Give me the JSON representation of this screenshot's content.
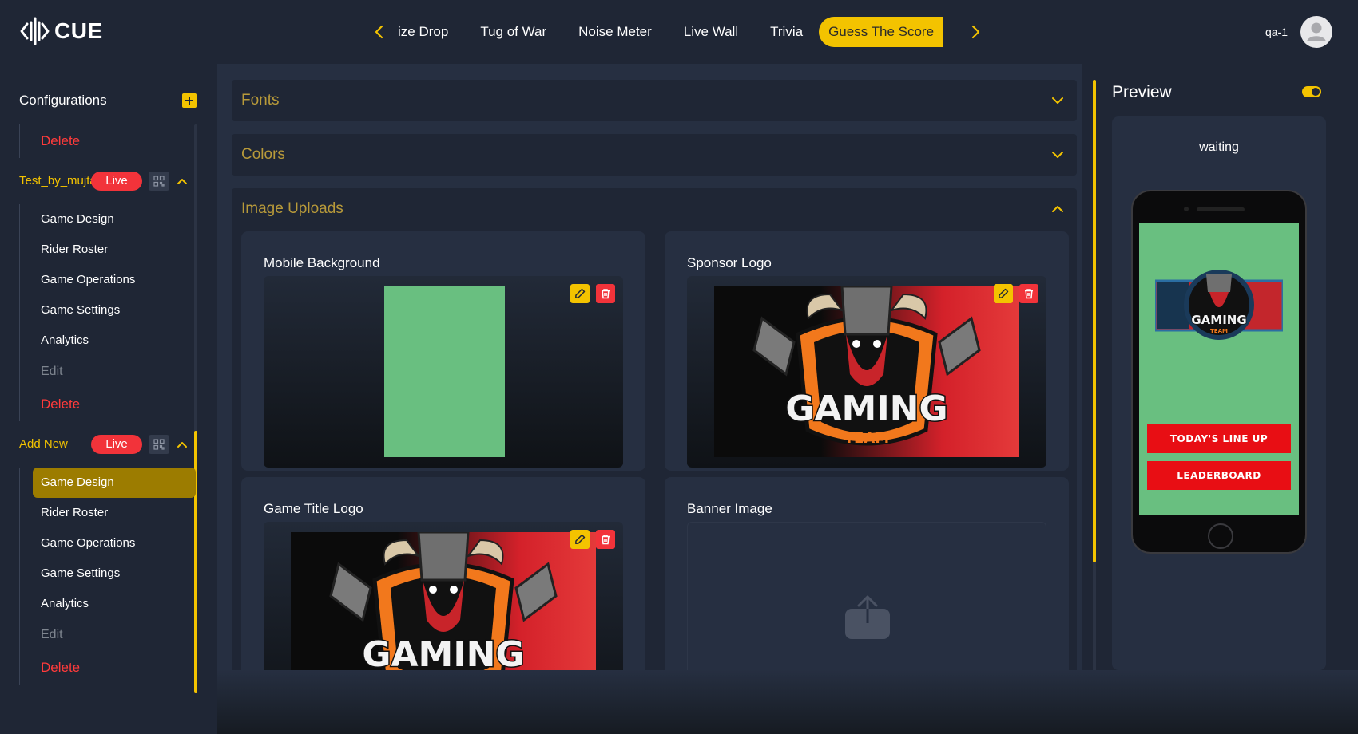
{
  "app": {
    "logo_text": "CUE"
  },
  "nav": {
    "tabs": [
      "ize Drop",
      "Tug of War",
      "Noise Meter",
      "Live Wall",
      "Trivia",
      "Guess The Score"
    ],
    "active_tab": "Guess The Score"
  },
  "user": {
    "name": "qa-1"
  },
  "sidebar": {
    "title": "Configurations",
    "top_delete": "Delete",
    "configs": [
      {
        "name": "Test_by_mujtahid",
        "status": "Live",
        "items": [
          "Game Design",
          "Rider Roster",
          "Game Operations",
          "Game Settings",
          "Analytics"
        ],
        "edit": "Edit",
        "delete": "Delete"
      },
      {
        "name": "Add New",
        "status": "Live",
        "items": [
          "Game Design",
          "Rider Roster",
          "Game Operations",
          "Game Settings",
          "Analytics"
        ],
        "selected_item": "Game Design",
        "edit": "Edit",
        "delete": "Delete"
      }
    ]
  },
  "main": {
    "sections": [
      {
        "title": "Fonts",
        "expanded": false
      },
      {
        "title": "Colors",
        "expanded": false
      },
      {
        "title": "Image Uploads",
        "expanded": true
      }
    ],
    "uploads": [
      {
        "label": "Mobile Background",
        "has_image": true
      },
      {
        "label": "Sponsor Logo",
        "has_image": true
      },
      {
        "label": "Game Title Logo",
        "has_image": true
      },
      {
        "label": "Banner Image",
        "has_image": false
      }
    ],
    "logo_text": {
      "main": "GAMING",
      "sub": "TEAM"
    }
  },
  "preview": {
    "title": "Preview",
    "toggle_on": true,
    "status": "waiting",
    "buttons": [
      "TODAY'S LINE UP",
      "LEADERBOARD"
    ]
  },
  "colors": {
    "accent": "#f3c300",
    "danger": "#f2333a",
    "bg": "#1f2635",
    "panel": "#262f41",
    "preview_green": "#69bf80"
  }
}
